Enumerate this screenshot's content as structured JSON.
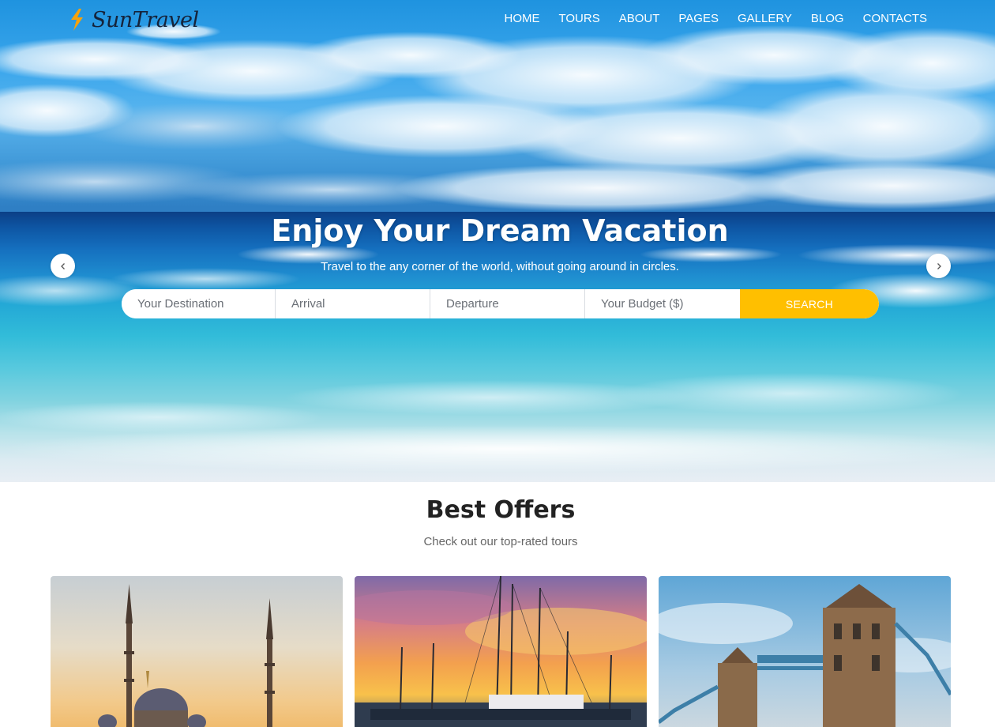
{
  "brand": {
    "name": "SunTravel",
    "accent": "#ffbf00",
    "logo_icon": "lightning-icon"
  },
  "nav": {
    "items": [
      {
        "label": "HOME"
      },
      {
        "label": "TOURS"
      },
      {
        "label": "ABOUT"
      },
      {
        "label": "PAGES"
      },
      {
        "label": "GALLERY"
      },
      {
        "label": "BLOG"
      },
      {
        "label": "CONTACTS"
      }
    ]
  },
  "hero": {
    "title": "Enjoy Your Dream Vacation",
    "subtitle": "Travel to the any corner of the world, without going around in circles.",
    "prev_icon": "chevron-left-icon",
    "next_icon": "chevron-right-icon"
  },
  "search": {
    "destination_placeholder": "Your Destination",
    "arrival_placeholder": "Arrival",
    "departure_placeholder": "Departure",
    "budget_placeholder": "Your Budget ($)",
    "button_label": "SEARCH"
  },
  "offers": {
    "title": "Best Offers",
    "subtitle": "Check out our top-rated tours",
    "cards": [
      {
        "image": "mosque-photo"
      },
      {
        "image": "harbor-sunset-photo"
      },
      {
        "image": "tower-bridge-photo"
      }
    ]
  }
}
